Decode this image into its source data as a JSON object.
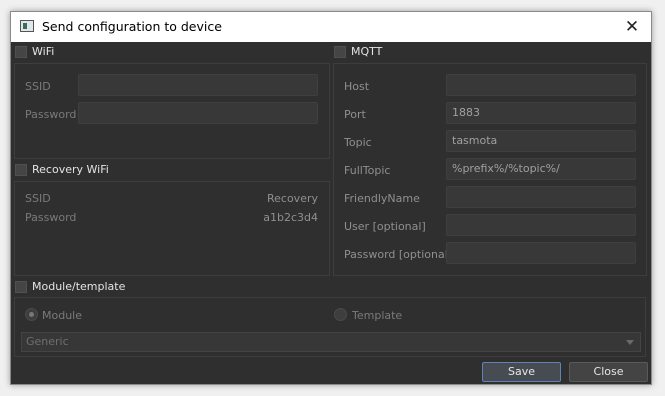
{
  "window": {
    "title": "Send configuration to device"
  },
  "wifi": {
    "title": "WiFi",
    "ssid_label": "SSID",
    "ssid_value": "",
    "password_label": "Password",
    "password_value": ""
  },
  "recovery": {
    "title": "Recovery WiFi",
    "ssid_label": "SSID",
    "ssid_value": "Recovery",
    "password_label": "Password",
    "password_value": "a1b2c3d4"
  },
  "mqtt": {
    "title": "MQTT",
    "fields": [
      {
        "label": "Host",
        "value": ""
      },
      {
        "label": "Port",
        "value": "1883"
      },
      {
        "label": "Topic",
        "value": "tasmota"
      },
      {
        "label": "FullTopic",
        "value": "%prefix%/%topic%/"
      },
      {
        "label": "FriendlyName",
        "value": ""
      },
      {
        "label": "User [optional]",
        "value": ""
      },
      {
        "label": "Password [optional]",
        "value": ""
      }
    ]
  },
  "module": {
    "title": "Module/template",
    "radio_module": "Module",
    "radio_template": "Template",
    "selected_radio": "Module",
    "combo_value": "Generic"
  },
  "buttons": {
    "save": "Save",
    "close": "Close"
  },
  "colors": {
    "dialog_bg": "#2f2f2f",
    "accent": "#5d83b8"
  }
}
